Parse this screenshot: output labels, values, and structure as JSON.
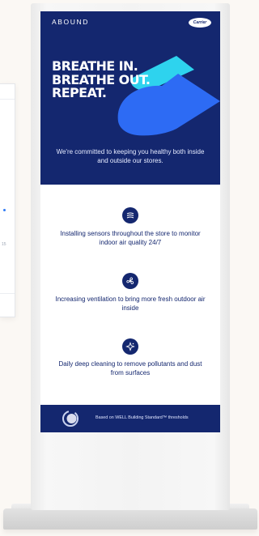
{
  "kiosk": {
    "logo": "ABOUND",
    "brand_badge": "Carrier",
    "headline": [
      "BREATHE IN.",
      "BREATHE OUT.",
      "REPEAT."
    ],
    "tagline": "We're committed to keeping you healthy both inside and outside our stores.",
    "features": [
      {
        "icon": "air-sensor-icon",
        "text": "Installing sensors throughout the store to monitor indoor air quality 24/7"
      },
      {
        "icon": "ventilation-fan-icon",
        "text": "Increasing ventilation to bring more fresh outdoor air inside"
      },
      {
        "icon": "cleaning-sparkle-icon",
        "text": "Daily deep cleaning to remove pollutants and dust from surfaces"
      }
    ],
    "footer_text": "Based on WELL Building Standard™ thresholds"
  },
  "colors": {
    "navy": "#14276f",
    "cyan_shape": "#2ed3ee",
    "blue_shape": "#2d6bf4",
    "page_bg": "#fbf8f4"
  },
  "background_card": {
    "tick_label": "15"
  }
}
